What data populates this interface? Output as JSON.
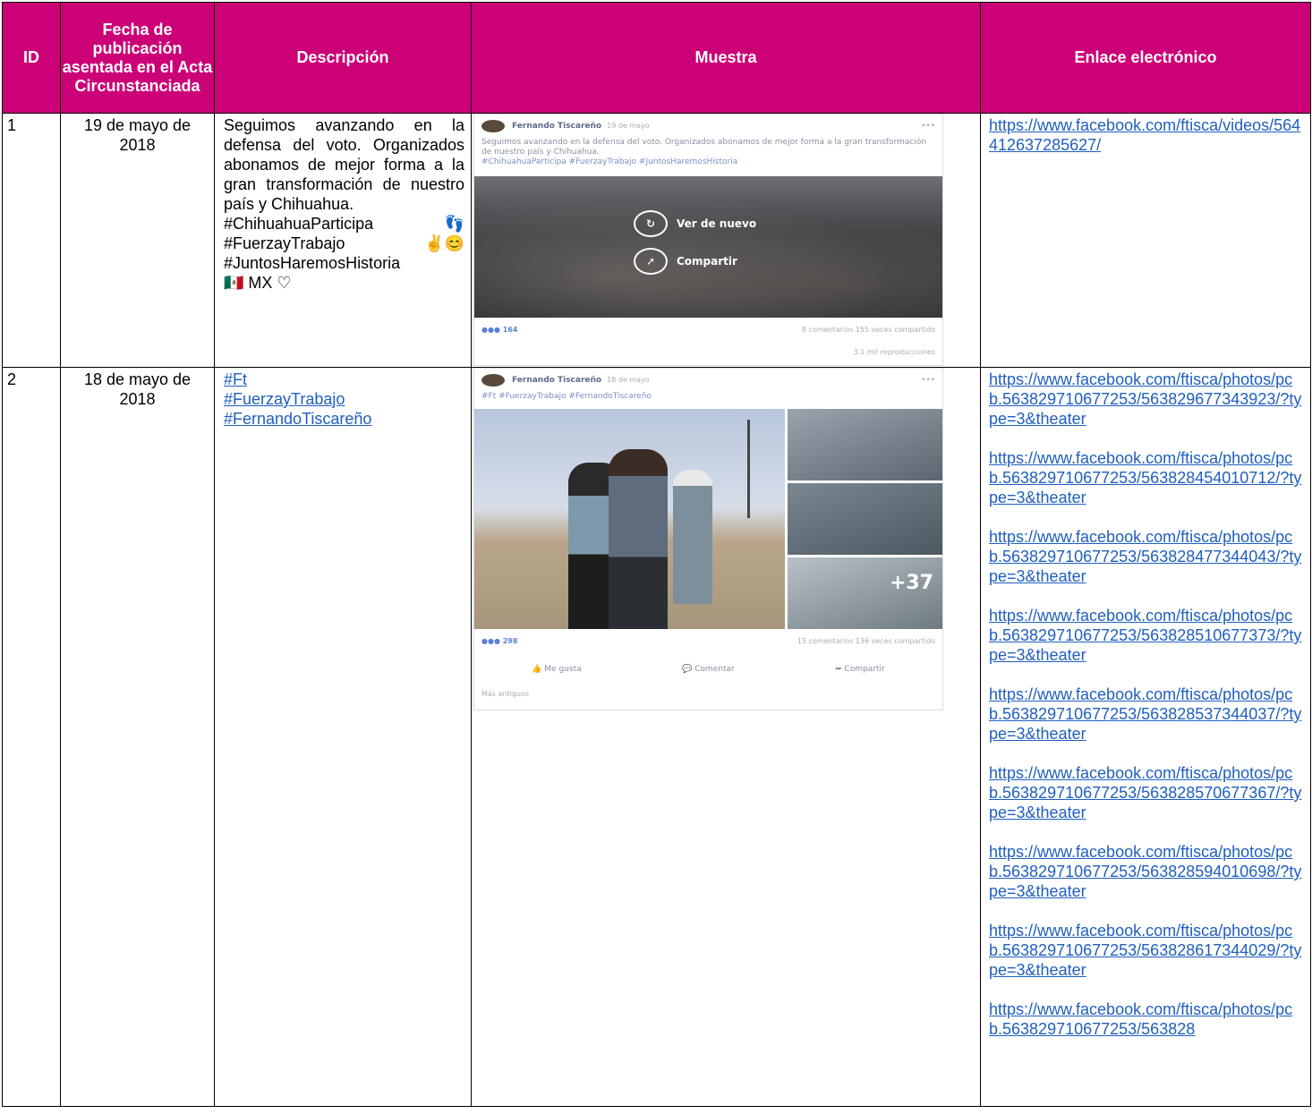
{
  "headers": {
    "id": "ID",
    "fecha": "Fecha de publicación asentada en el Acta Circunstanciada",
    "descripcion": "Descripción",
    "muestra": "Muestra",
    "enlace": "Enlace electrónico"
  },
  "rows": [
    {
      "id": "1",
      "fecha": "19 de mayo de 2018",
      "descripcion": {
        "p1": "Seguimos avanzando en la defensa del voto. Organizados abonamos de mejor forma a la gran transformación de nuestro país y Chihuahua.",
        "tag1": "#ChihuahuaParticipa",
        "emoji1": "👣",
        "tag2": "#FuerzayTrabajo",
        "emoji2": "✌😊",
        "tag3": "#JuntosHaremosHistoria",
        "tail": "🇲🇽 MX ♡"
      },
      "muestra": {
        "author": "Fernando Tiscareño",
        "date": "19 de mayo",
        "text": "Seguimos avanzando en la defensa del voto. Organizados abonamos de mejor forma a la gran transformación de nuestro país y Chihuahua.",
        "tags": "#ChihuahuaParticipa #FuerzayTrabajo #JuntosHaremosHistoria",
        "btn_replay": "Ver de nuevo",
        "btn_share": "Compartir",
        "reactions": "164",
        "stats": "8 comentarios  155 veces compartido",
        "views": "3.1 mil reproducciones"
      },
      "links": [
        "https://www.facebook.com/ftisca/videos/564412637285627/"
      ]
    },
    {
      "id": "2",
      "fecha": "18 de mayo de 2018",
      "descripcion": {
        "tags": [
          "#Ft",
          "#FuerzayTrabajo",
          "#FernandoTiscareño"
        ]
      },
      "muestra": {
        "author": "Fernando Tiscareño",
        "date": "18 de mayo",
        "tags": "#Ft #FuerzayTrabajo #FernandoTiscareño",
        "more": "+37",
        "reactions": "298",
        "stats": "15 comentarios  136 veces compartido",
        "like": "Me gusta",
        "comment": "Comentar",
        "share": "Compartir",
        "older": "Más antiguos"
      },
      "links": [
        "https://www.facebook.com/ftisca/photos/pcb.563829710677253/563829677343923/?type=3&theater",
        "https://www.facebook.com/ftisca/photos/pcb.563829710677253/563828454010712/?type=3&theater",
        "https://www.facebook.com/ftisca/photos/pcb.563829710677253/563828477344043/?type=3&theater",
        "https://www.facebook.com/ftisca/photos/pcb.563829710677253/563828510677373/?type=3&theater",
        "https://www.facebook.com/ftisca/photos/pcb.563829710677253/563828537344037/?type=3&theater",
        "https://www.facebook.com/ftisca/photos/pcb.563829710677253/563828570677367/?type=3&theater",
        "https://www.facebook.com/ftisca/photos/pcb.563829710677253/563828594010698/?type=3&theater",
        "https://www.facebook.com/ftisca/photos/pcb.563829710677253/563828617344029/?type=3&theater",
        "https://www.facebook.com/ftisca/photos/pcb.563829710677253/563828"
      ]
    }
  ]
}
